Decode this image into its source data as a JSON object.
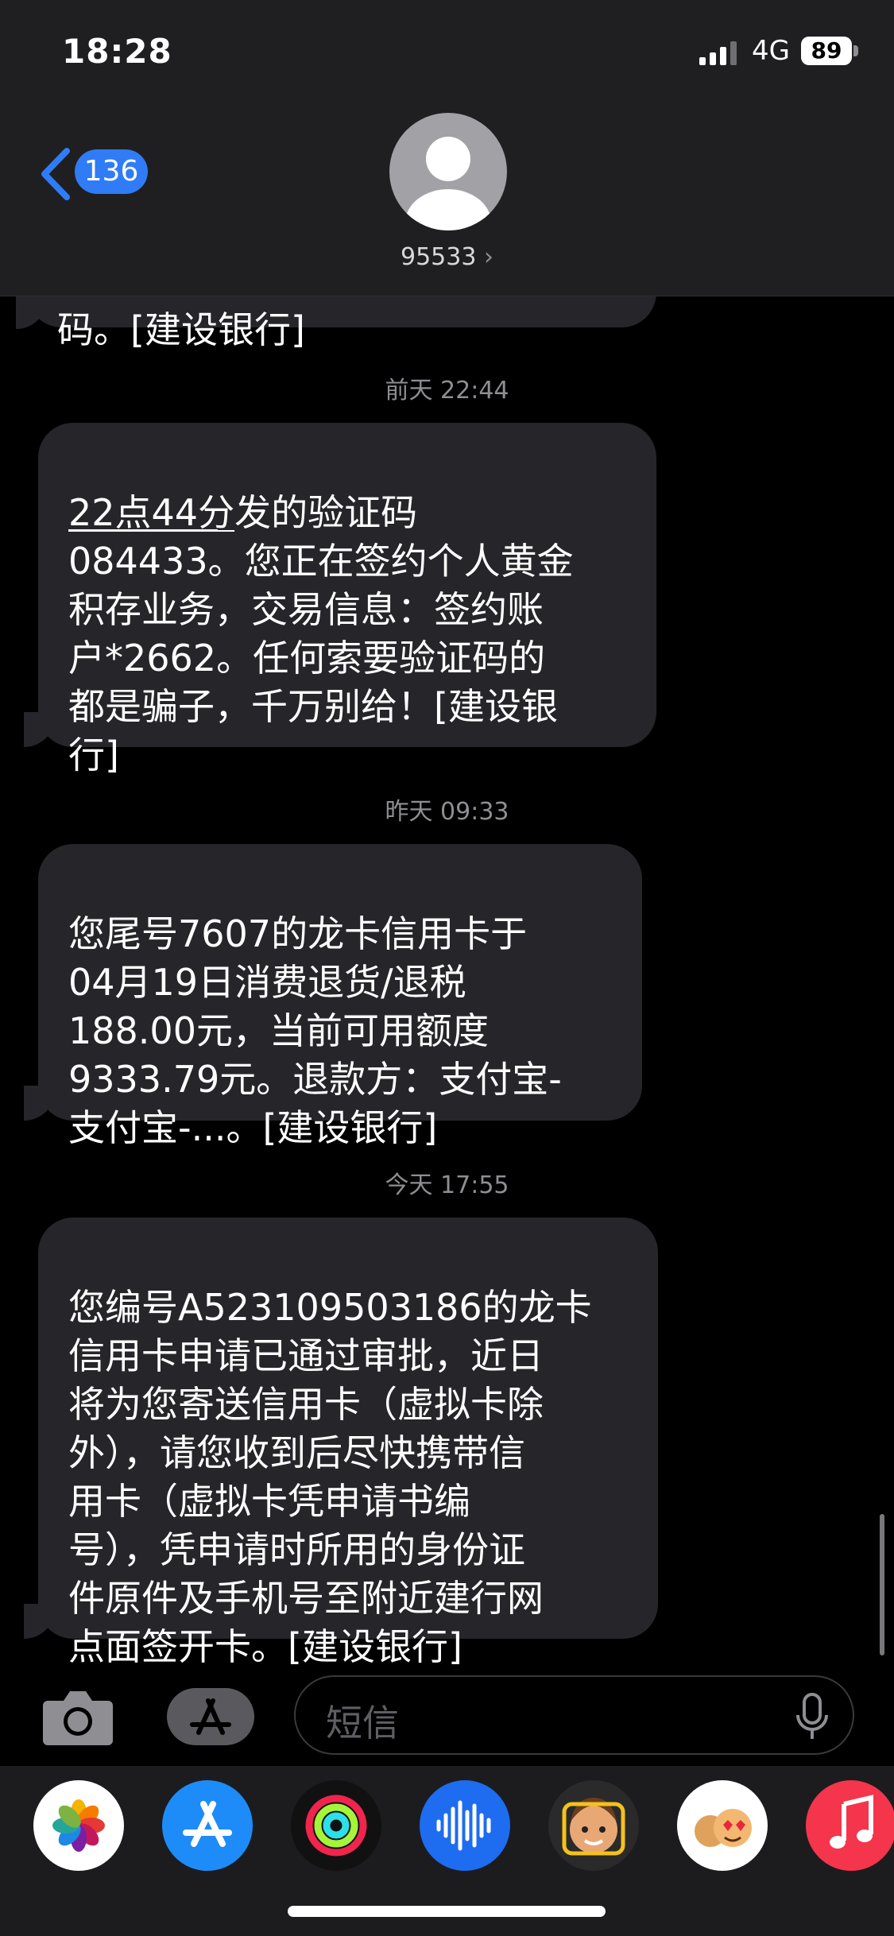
{
  "status_bar": {
    "time": "18:28",
    "network": "4G",
    "battery": "89"
  },
  "nav": {
    "back_count": "136",
    "contact": "95533",
    "chevron": "›"
  },
  "thread": {
    "partial_top": "码。[建设银行]",
    "messages": [
      {
        "timestamp": "前天 22:44",
        "text_underlined": "22点44分",
        "text_rest": "发的验证码\n084433。您正在签约个人黄金\n积存业务，交易信息：签约账\n户*2662。任何索要验证码的\n都是骗子，千万别给！[建设银\n行]",
        "underlined_code": "084433"
      },
      {
        "timestamp": "昨天 09:33",
        "text": "您尾号7607的龙卡信用卡于\n04月19日消费退货/退税\n188.00元，当前可用额度\n9333.79元。退款方：支付宝-\n支付宝-...。[建设银行]"
      },
      {
        "timestamp": "今天 17:55",
        "text": "您编号A523109503186的龙卡\n信用卡申请已通过审批，近日\n将为您寄送信用卡（虚拟卡除\n外），请您收到后尽快携带信\n用卡（虚拟卡凭申请书编\n号），凭申请时所用的身份证\n件原件及手机号至附近建行网\n点面签开卡。[建设银行]"
      }
    ]
  },
  "input": {
    "placeholder": "短信"
  },
  "apps": [
    {
      "name": "photos-icon",
      "color": "#ffffff"
    },
    {
      "name": "app-store-icon",
      "color": "#1e8cf8"
    },
    {
      "name": "fitness-icon",
      "color": "#111111"
    },
    {
      "name": "audio-message-icon",
      "color": "#1e6cf0"
    },
    {
      "name": "memoji-icon",
      "color": "#2a2a2a"
    },
    {
      "name": "animoji-stickers-icon",
      "color": "#ffffff"
    },
    {
      "name": "music-icon",
      "color": "#f4354c"
    }
  ]
}
